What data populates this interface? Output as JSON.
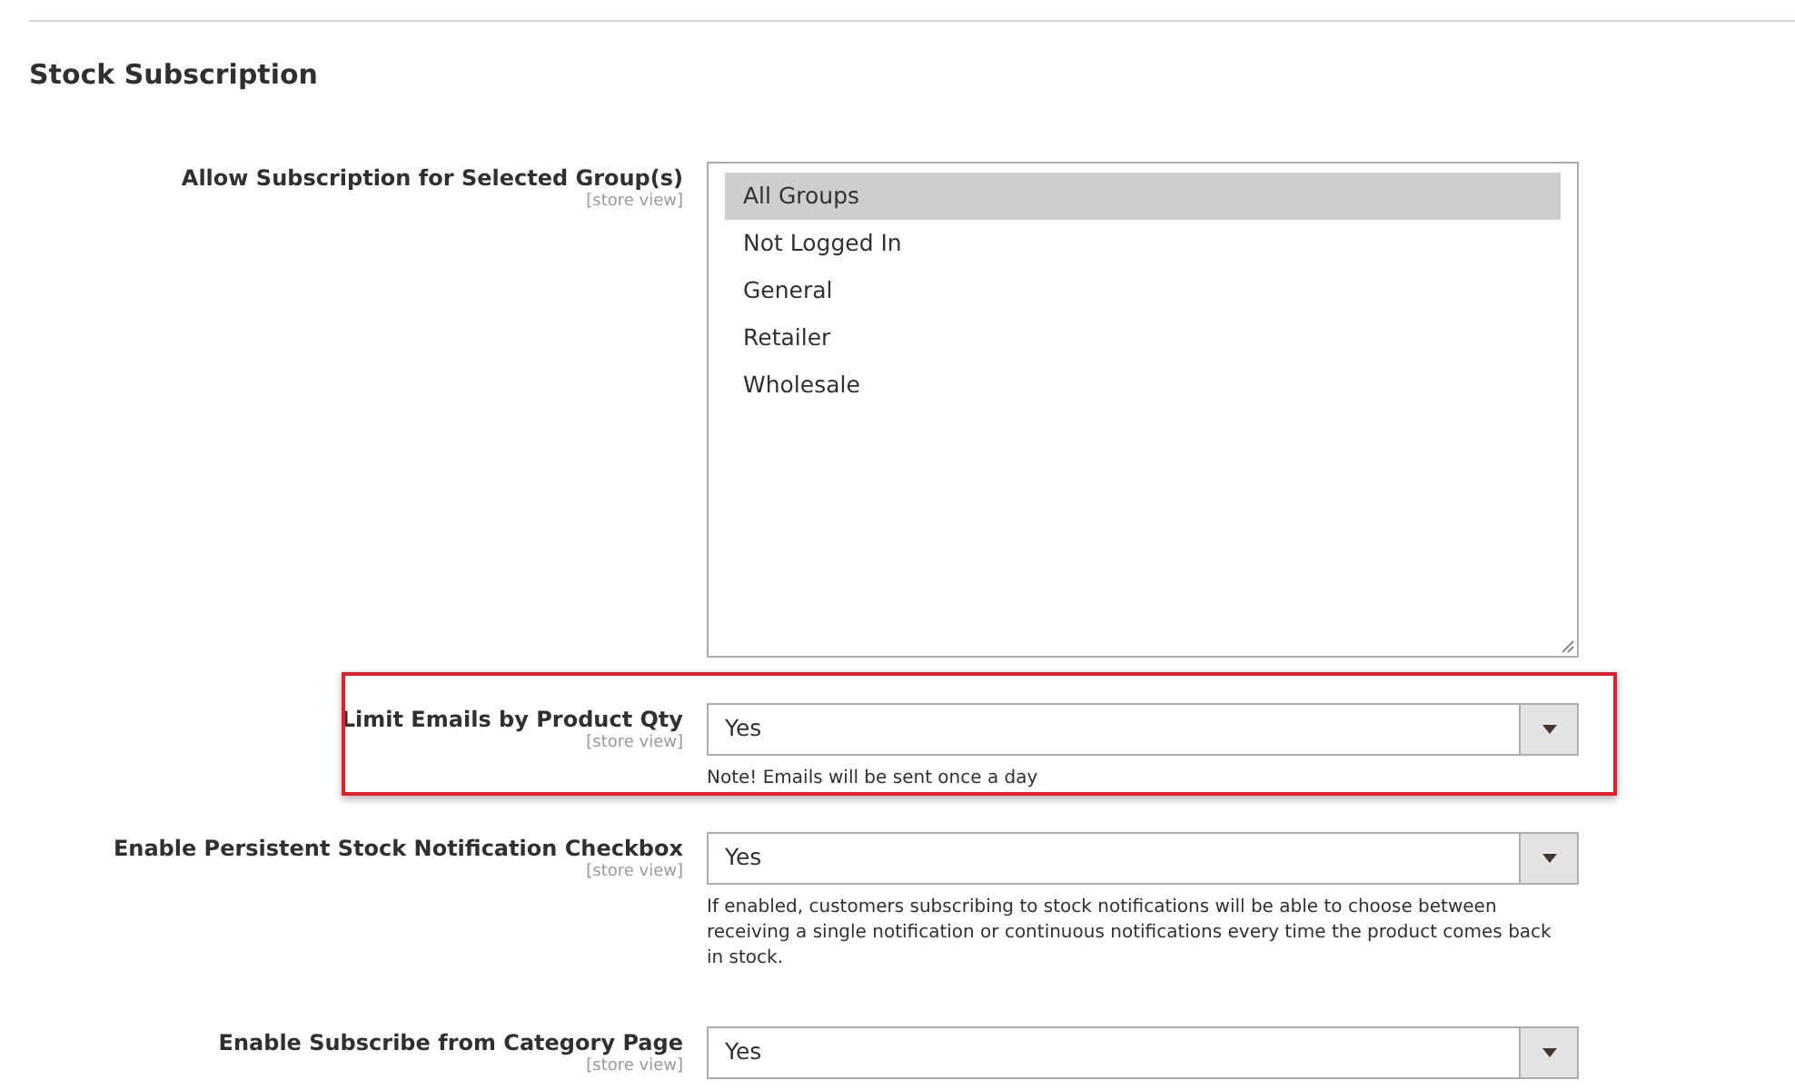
{
  "section": {
    "title": "Stock Subscription"
  },
  "fields": [
    {
      "kind": "multiselect",
      "label": "Allow Subscription for Selected Group(s)",
      "scope": "[store view]",
      "options": [
        {
          "label": "All Groups",
          "selected": true
        },
        {
          "label": "Not Logged In",
          "selected": false
        },
        {
          "label": "General",
          "selected": false
        },
        {
          "label": "Retailer",
          "selected": false
        },
        {
          "label": "Wholesale",
          "selected": false
        }
      ]
    },
    {
      "kind": "select",
      "label": "Limit Emails by Product Qty",
      "scope": "[store view]",
      "value": "Yes",
      "note": "Note! Emails will be sent once a day",
      "highlighted": true
    },
    {
      "kind": "select",
      "label": "Enable Persistent Stock Notification Checkbox",
      "scope": "[store view]",
      "value": "Yes",
      "note": "If enabled, customers subscribing to stock notifications will be able to choose between receiving a single notification or continuous notifications every time the product comes back in stock.",
      "highlighted": false
    },
    {
      "kind": "select",
      "label": "Enable Subscribe from Category Page",
      "scope": "[store view]",
      "value": "Yes",
      "highlighted": false
    }
  ]
}
